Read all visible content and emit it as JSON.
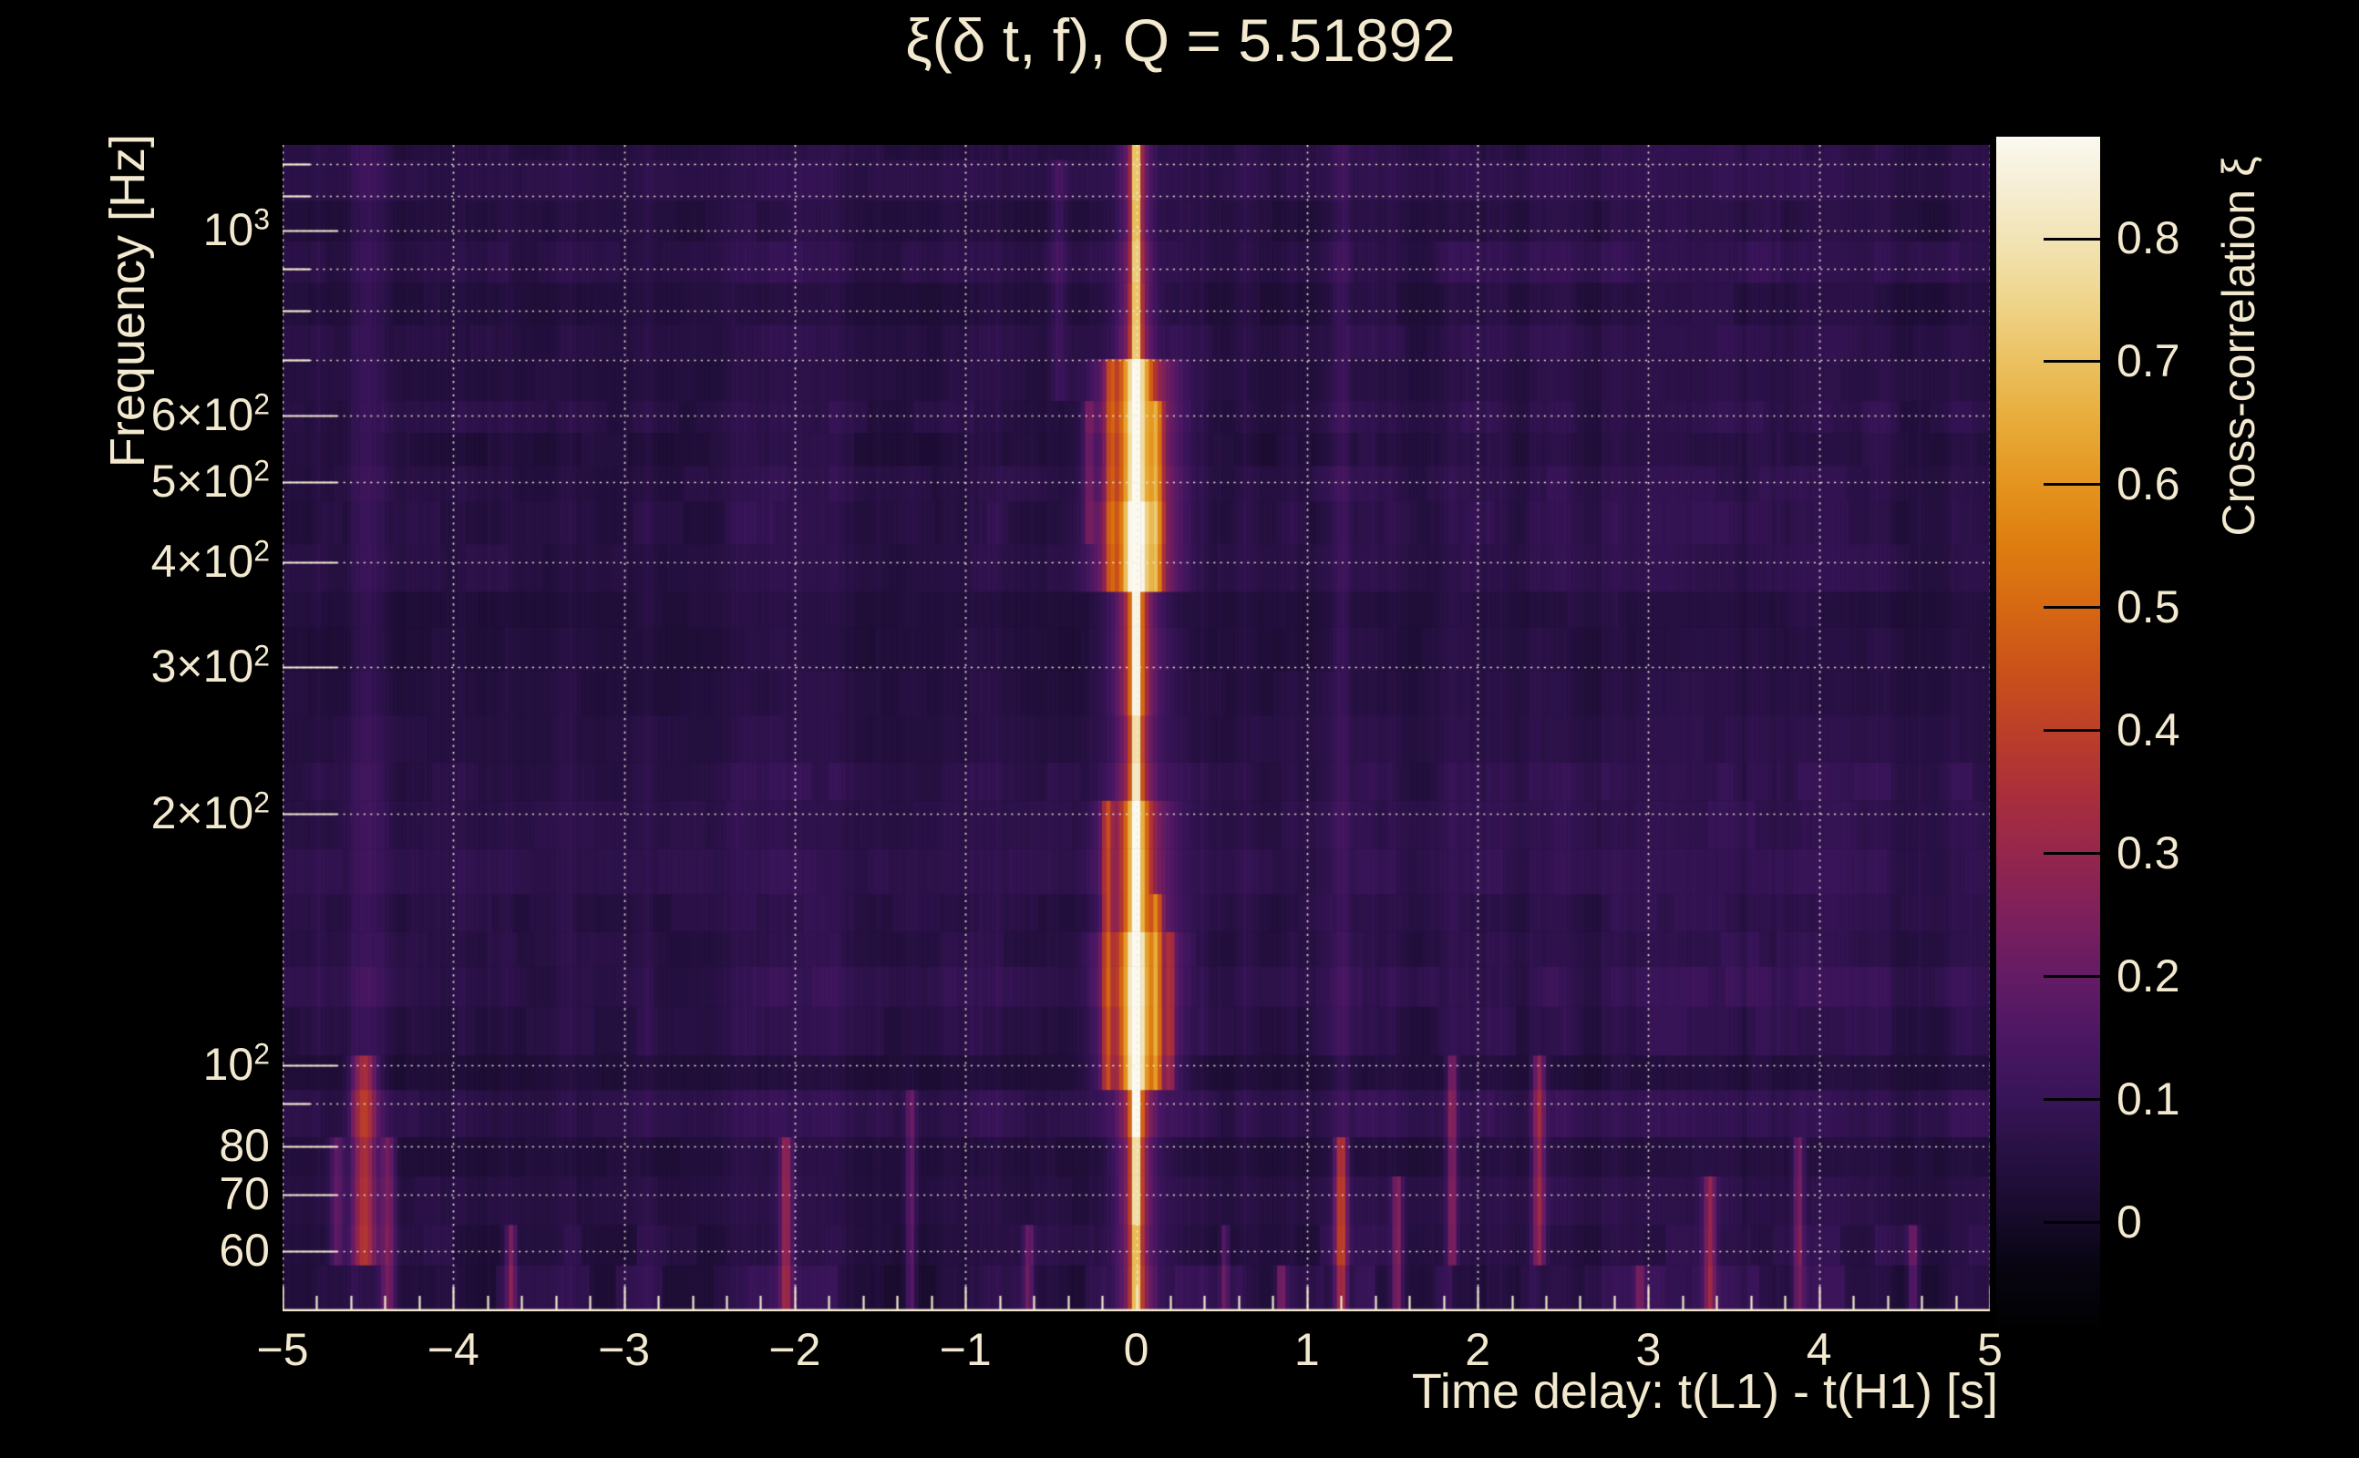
{
  "page": {
    "background": "#000000",
    "text_color": "#f2e9cf"
  },
  "chart_data": {
    "type": "heatmap",
    "title": "ξ(δ t, f), Q = 5.51892",
    "xlabel": "Time delay: t(L1) - t(H1) [s]",
    "ylabel": "Frequency [Hz]",
    "colorbar_label": "Cross-correlation ξ",
    "x_range": [
      -5,
      5
    ],
    "x_tick_values": [
      -5,
      -4,
      -3,
      -2,
      -1,
      0,
      1,
      2,
      3,
      4,
      5
    ],
    "x_tick_labels": [
      "−5",
      "−4",
      "−3",
      "−2",
      "−1",
      "0",
      "1",
      "2",
      "3",
      "4",
      "5"
    ],
    "x_minor_tick_step": 0.2,
    "y_scale": "log",
    "y_range_hz": [
      50.8,
      1265
    ],
    "y_grid_hz": [
      60,
      70,
      80,
      90,
      100,
      200,
      300,
      400,
      500,
      600,
      700,
      800,
      900,
      1000,
      1100,
      1200
    ],
    "y_labeled_ticks": [
      {
        "text": "10",
        "sup": "3",
        "hz": 1000
      },
      {
        "text": "6×10",
        "sup": "2",
        "hz": 600
      },
      {
        "text": "5×10",
        "sup": "2",
        "hz": 500
      },
      {
        "text": "4×10",
        "sup": "2",
        "hz": 400
      },
      {
        "text": "3×10",
        "sup": "2",
        "hz": 300
      },
      {
        "text": "2×10",
        "sup": "2",
        "hz": 200
      },
      {
        "text": "10",
        "sup": "2",
        "hz": 100
      },
      {
        "text": "80",
        "sup": "",
        "hz": 80
      },
      {
        "text": "70",
        "sup": "",
        "hz": 70
      },
      {
        "text": "60",
        "sup": "",
        "hz": 60
      }
    ],
    "grid": {
      "style": "dotted",
      "color": "#f2e9cf"
    },
    "colorbar": {
      "min": -0.087,
      "max": 0.883,
      "ticks": [
        {
          "label": "0.8",
          "value": 0.8
        },
        {
          "label": "0.7",
          "value": 0.7
        },
        {
          "label": "0.6",
          "value": 0.6
        },
        {
          "label": "0.5",
          "value": 0.5
        },
        {
          "label": "0.4",
          "value": 0.4
        },
        {
          "label": "0.3",
          "value": 0.3
        },
        {
          "label": "0.2",
          "value": 0.2
        },
        {
          "label": "0.1",
          "value": 0.1
        },
        {
          "label": "0",
          "value": 0.0
        }
      ]
    },
    "colormap_stops": [
      {
        "v": -0.087,
        "c": "#010101"
      },
      {
        "v": -0.03,
        "c": "#090514"
      },
      {
        "v": 0.0,
        "c": "#150a28"
      },
      {
        "v": 0.05,
        "c": "#251040"
      },
      {
        "v": 0.1,
        "c": "#371457"
      },
      {
        "v": 0.15,
        "c": "#4b1763"
      },
      {
        "v": 0.2,
        "c": "#641b64"
      },
      {
        "v": 0.25,
        "c": "#7d205c"
      },
      {
        "v": 0.3,
        "c": "#95264c"
      },
      {
        "v": 0.35,
        "c": "#aa2f3a"
      },
      {
        "v": 0.4,
        "c": "#bc3f28"
      },
      {
        "v": 0.45,
        "c": "#cb521a"
      },
      {
        "v": 0.5,
        "c": "#d66812"
      },
      {
        "v": 0.55,
        "c": "#de7d10"
      },
      {
        "v": 0.6,
        "c": "#e4941e"
      },
      {
        "v": 0.65,
        "c": "#e8ab38"
      },
      {
        "v": 0.7,
        "c": "#ebc160"
      },
      {
        "v": 0.75,
        "c": "#efd58c"
      },
      {
        "v": 0.8,
        "c": "#f2e4b6"
      },
      {
        "v": 0.85,
        "c": "#f7f0da"
      },
      {
        "v": 0.883,
        "c": "#fbf9f0"
      }
    ],
    "peak": {
      "time_delay_s": 0.0,
      "max_xi": 0.88
    },
    "background_noise": {
      "base": 0.022,
      "column_amp": 0.055,
      "block_amp": 0.045
    },
    "features": {
      "zero_delay_ridge": {
        "t": 0.0,
        "core_halfwidth_s": 0.013,
        "profile": [
          {
            "f_lo": 50,
            "f_hi": 62,
            "amp": 0.4,
            "sigma_s": 0.03
          },
          {
            "f_lo": 62,
            "f_hi": 80,
            "amp": 0.46,
            "sigma_s": 0.028
          },
          {
            "f_lo": 80,
            "f_hi": 95,
            "amp": 0.52,
            "sigma_s": 0.03
          },
          {
            "f_lo": 95,
            "f_hi": 145,
            "amp": 0.72,
            "sigma_s": 0.05
          },
          {
            "f_lo": 145,
            "f_hi": 210,
            "amp": 0.6,
            "sigma_s": 0.045
          },
          {
            "f_lo": 210,
            "f_hi": 270,
            "amp": 0.46,
            "sigma_s": 0.03
          },
          {
            "f_lo": 270,
            "f_hi": 360,
            "amp": 0.52,
            "sigma_s": 0.035
          },
          {
            "f_lo": 360,
            "f_hi": 460,
            "amp": 0.76,
            "sigma_s": 0.055
          },
          {
            "f_lo": 460,
            "f_hi": 700,
            "amp": 0.68,
            "sigma_s": 0.055
          },
          {
            "f_lo": 700,
            "f_hi": 900,
            "amp": 0.42,
            "sigma_s": 0.028
          },
          {
            "f_lo": 900,
            "f_hi": 1265,
            "amp": 0.42,
            "sigma_s": 0.022
          }
        ]
      },
      "side_streaks": [
        {
          "t": -0.17,
          "f_lo": 95,
          "f_hi": 210,
          "amp": 0.25,
          "sigma_s": 0.02
        },
        {
          "t": 0.12,
          "f_lo": 95,
          "f_hi": 160,
          "amp": 0.3,
          "sigma_s": 0.02
        },
        {
          "t": 0.2,
          "f_lo": 95,
          "f_hi": 145,
          "amp": 0.18,
          "sigma_s": 0.015
        },
        {
          "t": 0.12,
          "f_lo": 360,
          "f_hi": 650,
          "amp": 0.3,
          "sigma_s": 0.025
        },
        {
          "t": -0.15,
          "f_lo": 360,
          "f_hi": 700,
          "amp": 0.22,
          "sigma_s": 0.02
        },
        {
          "t": -0.28,
          "f_lo": 400,
          "f_hi": 620,
          "amp": 0.12,
          "sigma_s": 0.02
        },
        {
          "t": -0.45,
          "f_lo": 600,
          "f_hi": 1200,
          "amp": 0.07,
          "sigma_s": 0.03
        },
        {
          "t": 1.2,
          "f_lo": 60,
          "f_hi": 1265,
          "amp": 0.05,
          "sigma_s": 0.03
        },
        {
          "t": -4.5,
          "f_lo": 100,
          "f_hi": 1265,
          "amp": 0.04,
          "sigma_s": 0.05
        }
      ],
      "low_freq_streaks": [
        {
          "t": -4.52,
          "f_lo": 56,
          "f_hi": 100,
          "amp": 0.3,
          "sigma_s": 0.05
        },
        {
          "t": -4.38,
          "f_lo": 52,
          "f_hi": 80,
          "amp": 0.18,
          "sigma_s": 0.03
        },
        {
          "t": -4.68,
          "f_lo": 55,
          "f_hi": 85,
          "amp": 0.15,
          "sigma_s": 0.03
        },
        {
          "t": -3.66,
          "f_lo": 50,
          "f_hi": 64,
          "amp": 0.2,
          "sigma_s": 0.02
        },
        {
          "t": -2.05,
          "f_lo": 50,
          "f_hi": 78,
          "amp": 0.24,
          "sigma_s": 0.025
        },
        {
          "t": -1.32,
          "f_lo": 52,
          "f_hi": 90,
          "amp": 0.15,
          "sigma_s": 0.02
        },
        {
          "t": -0.63,
          "f_lo": 50,
          "f_hi": 62,
          "amp": 0.16,
          "sigma_s": 0.02
        },
        {
          "t": 0.52,
          "f_lo": 50,
          "f_hi": 62,
          "amp": 0.15,
          "sigma_s": 0.015
        },
        {
          "t": 0.85,
          "f_lo": 50,
          "f_hi": 60,
          "amp": 0.18,
          "sigma_s": 0.02
        },
        {
          "t": 1.2,
          "f_lo": 50,
          "f_hi": 82,
          "amp": 0.3,
          "sigma_s": 0.025
        },
        {
          "t": 1.53,
          "f_lo": 50,
          "f_hi": 72,
          "amp": 0.2,
          "sigma_s": 0.02
        },
        {
          "t": 1.85,
          "f_lo": 55,
          "f_hi": 100,
          "amp": 0.2,
          "sigma_s": 0.02
        },
        {
          "t": 2.36,
          "f_lo": 55,
          "f_hi": 100,
          "amp": 0.24,
          "sigma_s": 0.025
        },
        {
          "t": 2.95,
          "f_lo": 50,
          "f_hi": 60,
          "amp": 0.15,
          "sigma_s": 0.02
        },
        {
          "t": 3.36,
          "f_lo": 50,
          "f_hi": 72,
          "amp": 0.22,
          "sigma_s": 0.025
        },
        {
          "t": 3.88,
          "f_lo": 50,
          "f_hi": 78,
          "amp": 0.18,
          "sigma_s": 0.02
        },
        {
          "t": 4.55,
          "f_lo": 50,
          "f_hi": 62,
          "amp": 0.16,
          "sigma_s": 0.02
        }
      ]
    }
  }
}
